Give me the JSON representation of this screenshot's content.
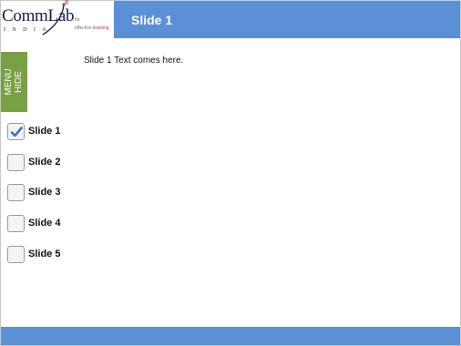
{
  "logo": {
    "brand": "CommLab",
    "country": "INDIA",
    "tag_for": "for",
    "tag_effective": "effective",
    "tag_learning": "learning"
  },
  "header": {
    "title": "Slide 1"
  },
  "menu_tab": {
    "label": "MENU\nHIDE"
  },
  "content": {
    "text": "Slide 1 Text comes here."
  },
  "menu": {
    "items": [
      {
        "label": "Slide 1",
        "checked": true
      },
      {
        "label": "Slide 2",
        "checked": false
      },
      {
        "label": "Slide 3",
        "checked": false
      },
      {
        "label": "Slide 4",
        "checked": false
      },
      {
        "label": "Slide 5",
        "checked": false
      }
    ]
  },
  "colors": {
    "header_blue": "#5b8fd6",
    "menu_green": "#78a045",
    "check_blue": "#3b73c4"
  }
}
